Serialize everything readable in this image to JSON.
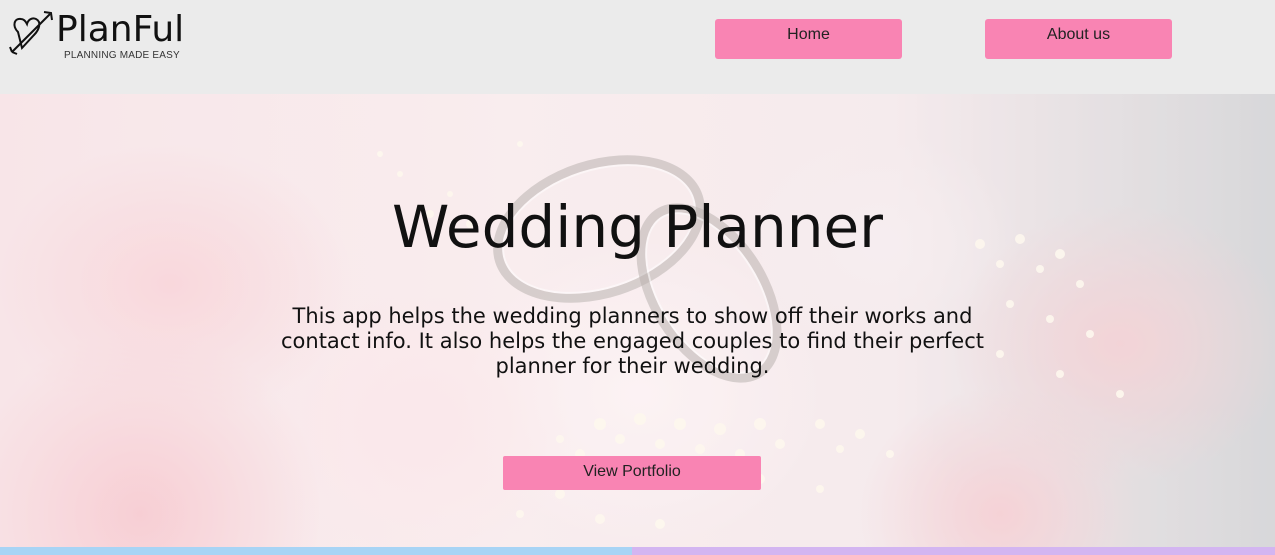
{
  "header": {
    "logo": {
      "title": "PlanFul",
      "tagline": "PLANNING MADE EASY",
      "icon": "heart-arrow-icon"
    },
    "nav": {
      "home_label": "Home",
      "about_label": "About us"
    }
  },
  "hero": {
    "title": "Wedding Planner",
    "description": "This app helps the wedding planners to show off their works and contact info. It also helps the engaged couples to find their perfect planner for their wedding.",
    "cta_label": "View Portfolio",
    "background": "wedding-rings-flowers-image"
  },
  "colors": {
    "accent": "#f984b3",
    "header_bg": "#ebebeb",
    "bar_blue": "#a8d4f5",
    "bar_purple": "#d3b5f1"
  }
}
